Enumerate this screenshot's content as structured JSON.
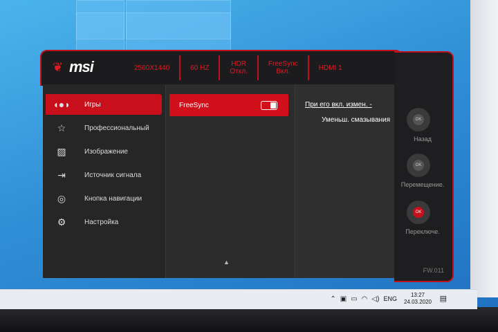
{
  "header": {
    "brand": "msi",
    "cells": [
      {
        "line1": "2560X1440",
        "line2": ""
      },
      {
        "line1": "60 HZ",
        "line2": ""
      },
      {
        "line1": "HDR",
        "line2": "Откл."
      },
      {
        "line1": "FreeSync",
        "line2": "Вкл."
      },
      {
        "line1": "HDMI 1",
        "line2": ""
      }
    ]
  },
  "nav": {
    "items": [
      {
        "label": "Игры",
        "icon": "gamepad-icon",
        "active": true
      },
      {
        "label": "Профессиональный",
        "icon": "star-icon",
        "active": false
      },
      {
        "label": "Изображение",
        "icon": "image-icon",
        "active": false
      },
      {
        "label": "Источник сигнала",
        "icon": "input-source-icon",
        "active": false
      },
      {
        "label": "Кнопка навигации",
        "icon": "navigation-key-icon",
        "active": false
      },
      {
        "label": "Настройка",
        "icon": "gear-icon",
        "active": false
      }
    ]
  },
  "submenu": {
    "item_label": "FreeSync",
    "toggle_on": true,
    "scroll_glyph": "▲"
  },
  "description": {
    "line1": "При его вкл. измен. -",
    "line2": "Уменьш. смазывания"
  },
  "controls": {
    "ok_label": "OK",
    "back_label": "Назад",
    "move_label": "Перемещение.",
    "switch_label": "Переключе."
  },
  "firmware": "FW.011",
  "taskbar": {
    "language": "ENG",
    "time": "13:27",
    "date": "24.03.2020"
  },
  "colors": {
    "accent": "#c8101c",
    "panel": "#2a2a2b"
  }
}
